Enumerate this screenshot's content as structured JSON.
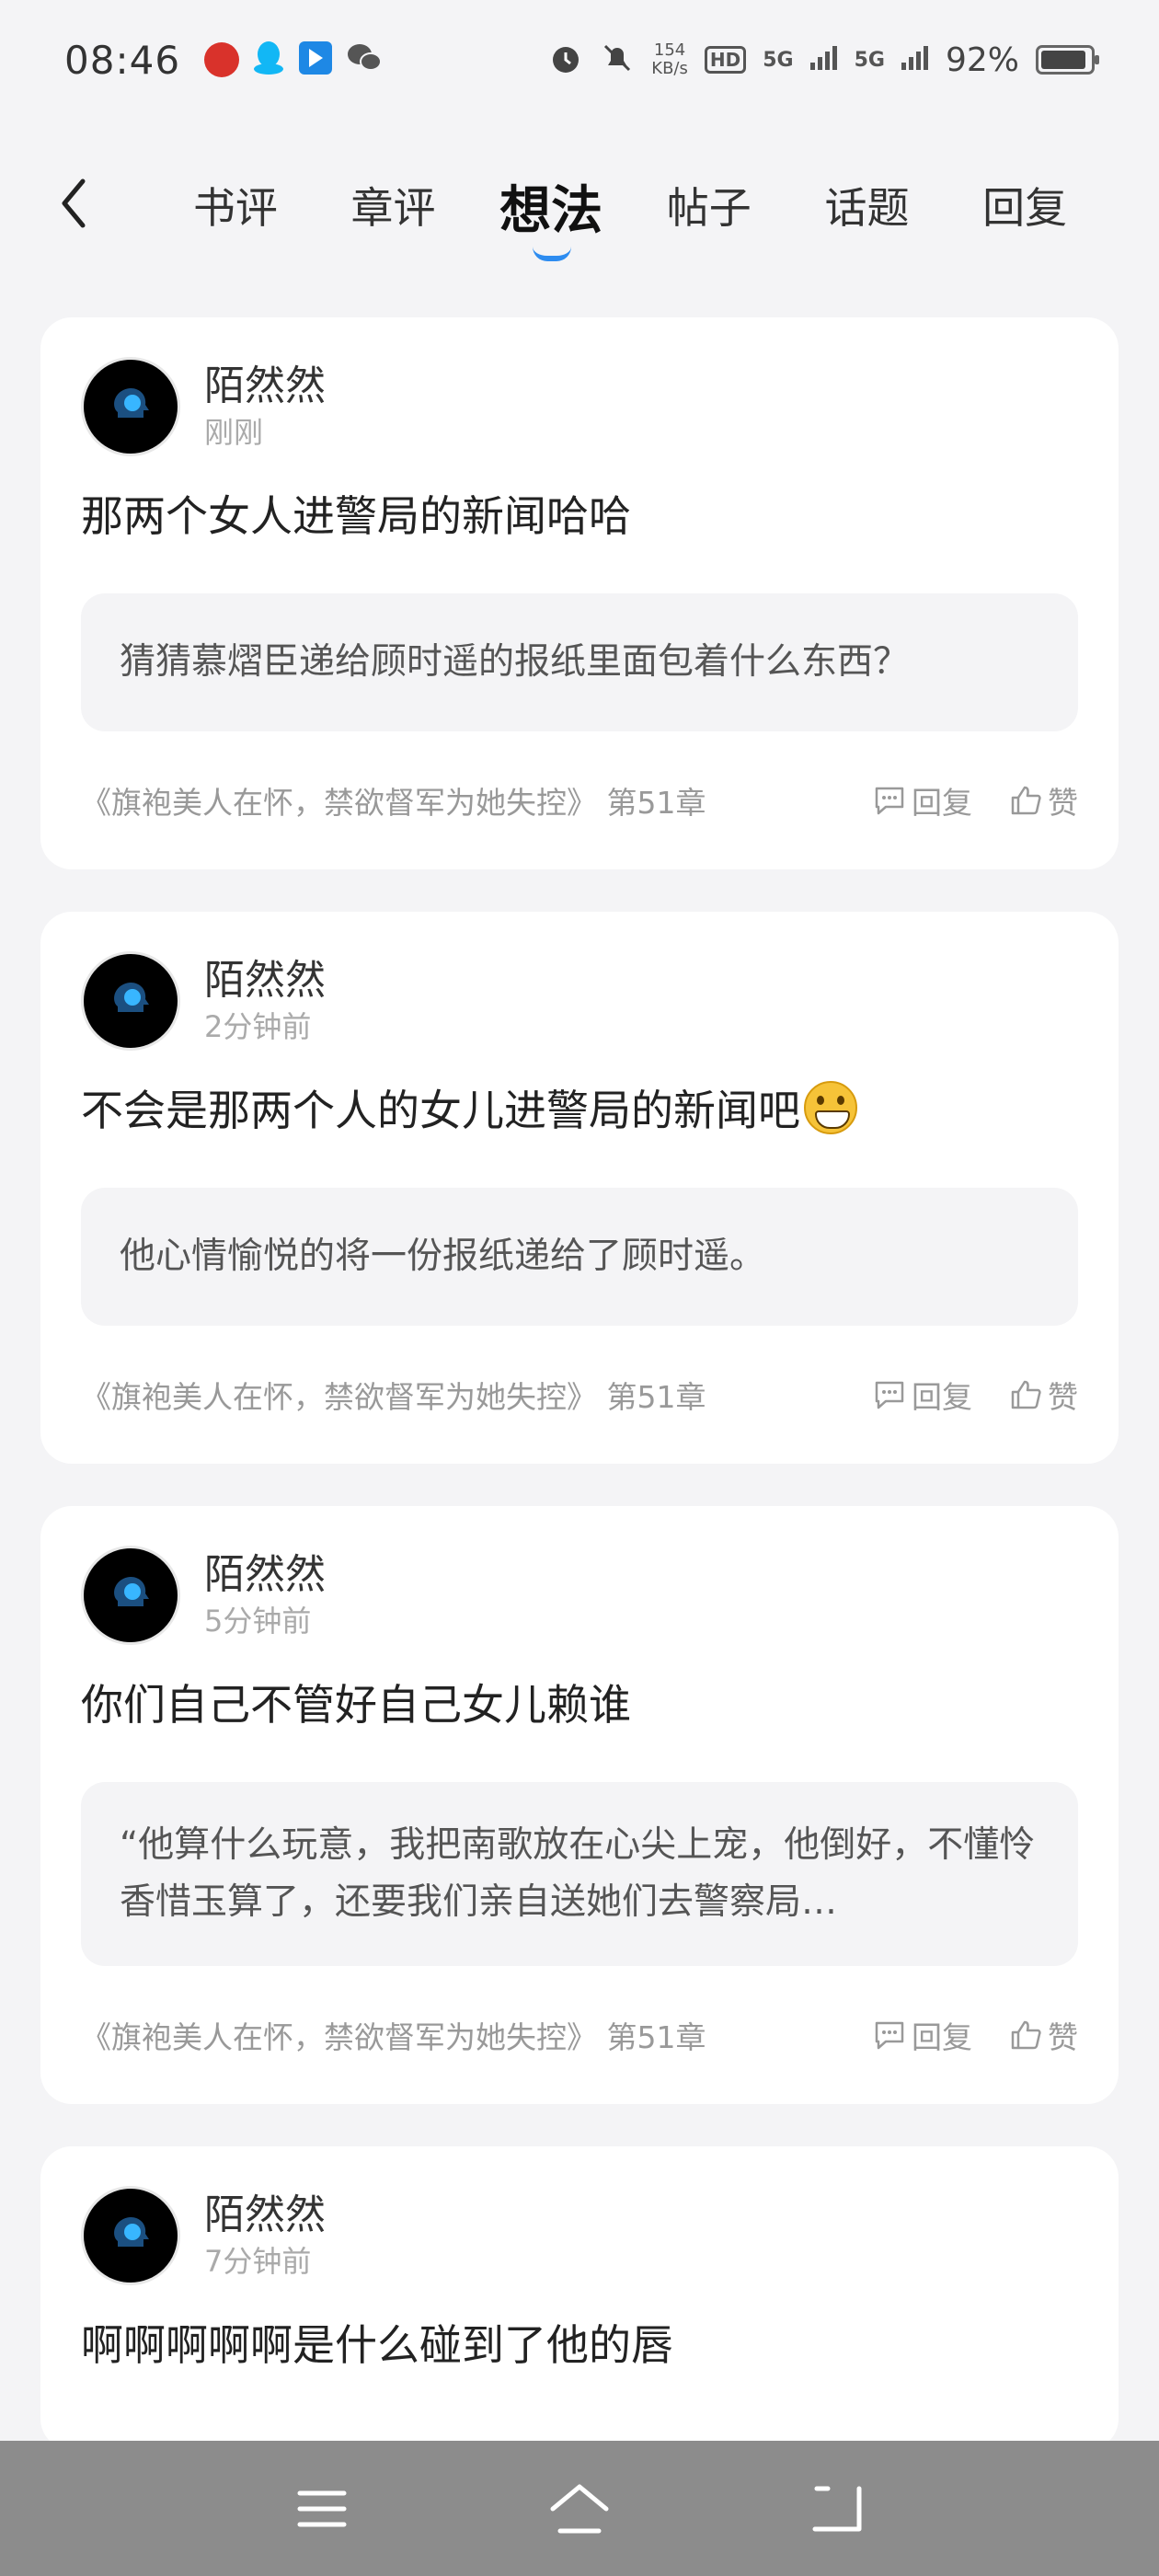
{
  "status_bar": {
    "time": "08:46",
    "net_speed_value": "154",
    "net_speed_unit": "KB/s",
    "hd_label": "HD",
    "signal1": "5G",
    "signal2": "5G",
    "battery": "92%"
  },
  "tabs": [
    {
      "label": "书评",
      "active": false
    },
    {
      "label": "章评",
      "active": false
    },
    {
      "label": "想法",
      "active": true
    },
    {
      "label": "帖子",
      "active": false
    },
    {
      "label": "话题",
      "active": false
    },
    {
      "label": "回复",
      "active": false
    }
  ],
  "posts": [
    {
      "username": "陌然然",
      "time": "刚刚",
      "content": "那两个女人进警局的新闻哈哈",
      "quote": "猜猜慕熠臣递给顾时遥的报纸里面包着什么东西？",
      "book_ref": "《旗袍美人在怀，禁欲督军为她失控》 第51章",
      "reply_label": "回复",
      "like_label": "赞"
    },
    {
      "username": "陌然然",
      "time": "2分钟前",
      "content": "不会是那两个人的女儿进警局的新闻吧",
      "emoji": "grin-emoji",
      "quote": "他心情愉悦的将一份报纸递给了顾时遥。",
      "book_ref": "《旗袍美人在怀，禁欲督军为她失控》 第51章",
      "reply_label": "回复",
      "like_label": "赞"
    },
    {
      "username": "陌然然",
      "time": "5分钟前",
      "content": "你们自己不管好自己女儿赖谁",
      "quote": "“他算什么玩意，我把南歌放在心尖上宠，他倒好，不懂怜香惜玉算了，还要我们亲自送她们去警察局…",
      "book_ref": "《旗袍美人在怀，禁欲督军为她失控》 第51章",
      "reply_label": "回复",
      "like_label": "赞"
    },
    {
      "username": "陌然然",
      "time": "7分钟前",
      "content": "啊啊啊啊啊是什么碰到了他的唇"
    }
  ],
  "colors": {
    "accent": "#2d8cf0",
    "background": "#f4f4f6",
    "nav_bar": "#8c8c8c"
  }
}
